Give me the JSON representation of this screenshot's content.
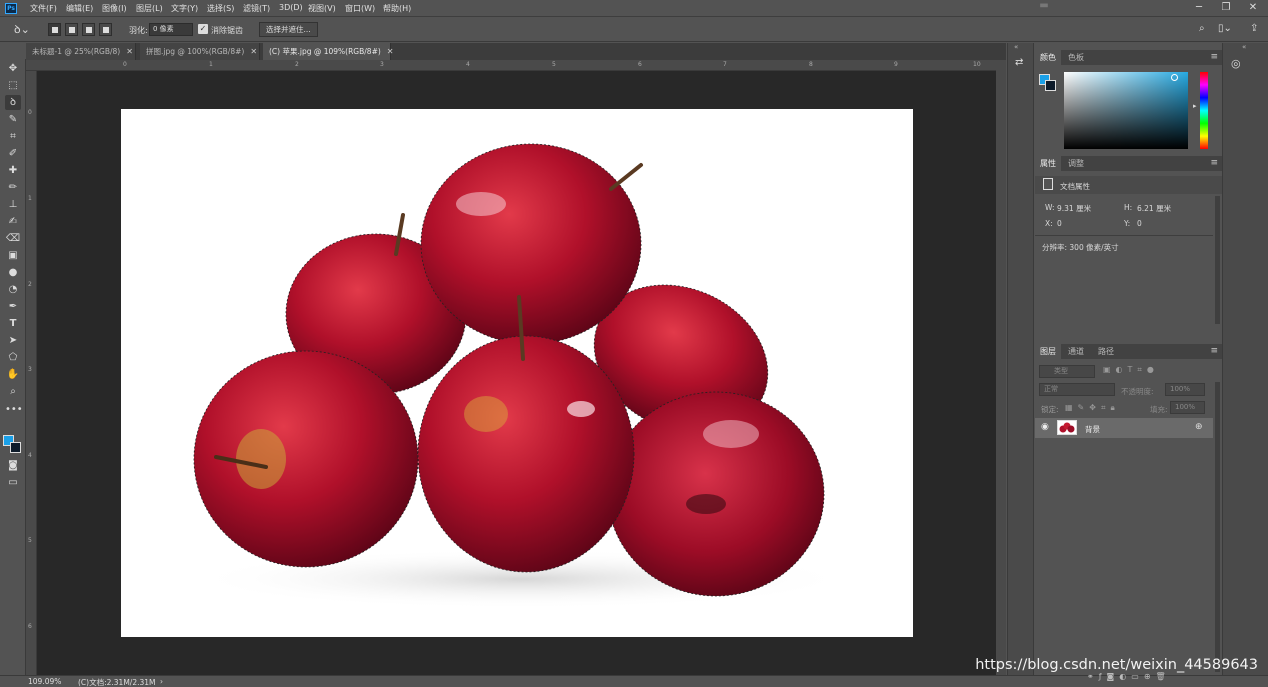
{
  "app": {
    "logo": "Ps",
    "menu": [
      "文件(F)",
      "编辑(E)",
      "图像(I)",
      "图层(L)",
      "文字(Y)",
      "选择(S)",
      "滤镜(T)",
      "3D(D)",
      "视图(V)",
      "窗口(W)",
      "帮助(H)"
    ]
  },
  "options": {
    "feather_label": "羽化:",
    "feather_value": "0 像素",
    "antialias_label": "消除锯齿",
    "antialias_checked": true,
    "select_mask_label": "选择并遮住..."
  },
  "tabs": [
    {
      "label": "未标题-1 @ 25%(RGB/8)",
      "active": false
    },
    {
      "label": "拼图.jpg @ 100%(RGB/8#)",
      "active": false
    },
    {
      "label": "(C) 苹果.jpg @ 109%(RGB/8#)",
      "active": true
    }
  ],
  "tools": [
    "move-icon",
    "marquee-icon",
    "lasso-icon",
    "quick-select-icon",
    "crop-icon",
    "eyedropper-icon",
    "healing-icon",
    "brush-icon",
    "stamp-icon",
    "history-brush-icon",
    "eraser-icon",
    "gradient-icon",
    "blur-icon",
    "dodge-icon",
    "pen-icon",
    "type-icon",
    "path-select-icon",
    "shape-icon",
    "hand-icon",
    "zoom-icon",
    "more-tools-icon"
  ],
  "ruler": {
    "top_ticks": [
      "0",
      "1",
      "2",
      "3",
      "4",
      "5",
      "6",
      "7",
      "8",
      "9",
      "10"
    ],
    "left_ticks": [
      "0",
      "1",
      "2",
      "3",
      "4",
      "5",
      "6"
    ]
  },
  "status": {
    "zoom": "109.09%",
    "doc_info": "(C)文档:2.31M/2.31M"
  },
  "colors": {
    "foreground": "#1aa0e8",
    "background": "#0d1b2a",
    "picker_hue": "#27a9e1"
  },
  "panels": {
    "color_tabs": [
      "颜色",
      "色板"
    ],
    "properties_tabs": [
      "属性",
      "调整"
    ],
    "doc_props_title": "文档属性",
    "w_label": "W:",
    "w_value": "9.31 厘米",
    "h_label": "H:",
    "h_value": "6.21 厘米",
    "x_label": "X:",
    "x_value": "0",
    "y_label": "Y:",
    "y_value": "0",
    "resolution": "分辨率: 300 像素/英寸",
    "layers_tabs": [
      "图层",
      "通道",
      "路径"
    ],
    "layer_filter": "类型",
    "blend_mode": "正常",
    "opacity_label": "不透明度:",
    "opacity_value": "100%",
    "lock_label": "锁定:",
    "fill_label": "填充:",
    "fill_value": "100%",
    "layer_name": "背景"
  },
  "watermark": "https://blog.csdn.net/weixin_44589643"
}
